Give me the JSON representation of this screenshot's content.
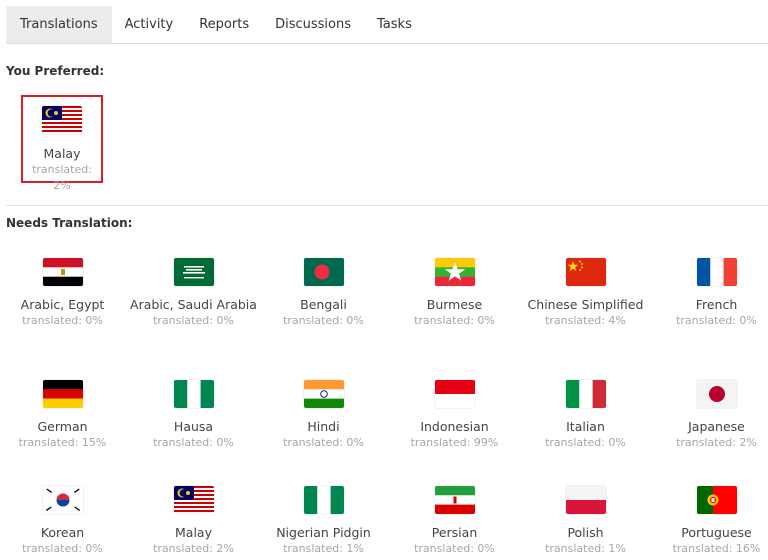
{
  "tabs": [
    "Translations",
    "Activity",
    "Reports",
    "Discussions",
    "Tasks"
  ],
  "preferred_title": "You Preferred:",
  "needs_title": "Needs Translation:",
  "preferred": {
    "name": "Malay",
    "pct": "translated: 2%",
    "flag": "malaysia-flag"
  },
  "languages": [
    {
      "name": "Arabic, Egypt",
      "pct": "translated: 0%",
      "flag": "egypt-flag"
    },
    {
      "name": "Arabic, Saudi Arabia",
      "pct": "translated: 0%",
      "flag": "saudi-arabia-flag"
    },
    {
      "name": "Bengali",
      "pct": "translated: 0%",
      "flag": "bangladesh-flag"
    },
    {
      "name": "Burmese",
      "pct": "translated: 0%",
      "flag": "myanmar-flag"
    },
    {
      "name": "Chinese Simplified",
      "pct": "translated: 4%",
      "flag": "china-flag"
    },
    {
      "name": "French",
      "pct": "translated: 0%",
      "flag": "france-flag"
    },
    {
      "name": "German",
      "pct": "translated: 15%",
      "flag": "germany-flag"
    },
    {
      "name": "Hausa",
      "pct": "translated: 0%",
      "flag": "nigeria-flag"
    },
    {
      "name": "Hindi",
      "pct": "translated: 0%",
      "flag": "india-flag"
    },
    {
      "name": "Indonesian",
      "pct": "translated: 99%",
      "flag": "indonesia-flag"
    },
    {
      "name": "Italian",
      "pct": "translated: 0%",
      "flag": "italy-flag"
    },
    {
      "name": "Japanese",
      "pct": "translated: 2%",
      "flag": "japan-flag"
    },
    {
      "name": "Korean",
      "pct": "translated: 0%",
      "flag": "south-korea-flag"
    },
    {
      "name": "Malay",
      "pct": "translated: 2%",
      "flag": "malaysia-flag"
    },
    {
      "name": "Nigerian Pidgin",
      "pct": "translated: 1%",
      "flag": "nigeria-flag"
    },
    {
      "name": "Persian",
      "pct": "translated: 0%",
      "flag": "iran-flag"
    },
    {
      "name": "Polish",
      "pct": "translated: 1%",
      "flag": "poland-flag"
    },
    {
      "name": "Portuguese",
      "pct": "translated: 16%",
      "flag": "portugal-flag"
    }
  ]
}
